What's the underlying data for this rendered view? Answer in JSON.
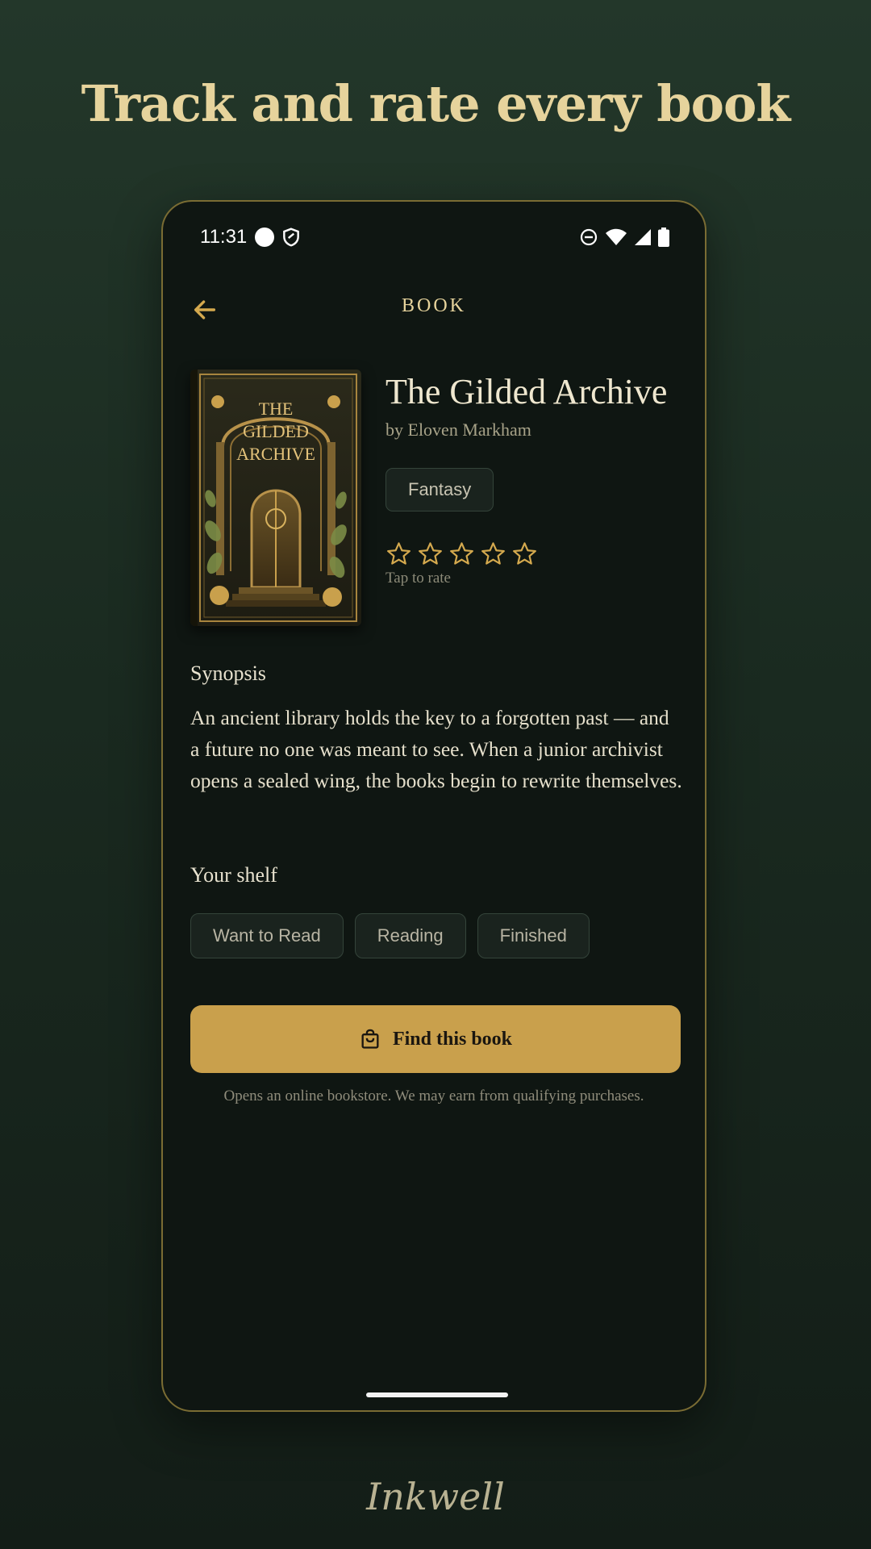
{
  "headline": "Track and rate every book",
  "status_bar": {
    "time": "11:31",
    "left_icons": [
      "notification-dot-icon",
      "shield-icon"
    ],
    "right_icons": [
      "do-not-disturb-icon",
      "wifi-icon",
      "signal-icon",
      "battery-icon"
    ]
  },
  "app_bar": {
    "title": "BOOK",
    "back_icon": "arrow-left-icon"
  },
  "book": {
    "title": "The Gilded Archive",
    "author": "by Eloven Markham",
    "genre": "Fantasy",
    "cover_text": [
      "THE",
      "GILDED",
      "ARCHIVE"
    ],
    "rating": {
      "value": 0,
      "max": 5
    },
    "rating_hint": "Tap to rate"
  },
  "synopsis": {
    "heading": "Synopsis",
    "text": "An ancient library holds the key to a forgotten past — and a future no one was meant to see. When a junior archivist opens a sealed wing, the books begin to rewrite themselves."
  },
  "shelf": {
    "heading": "Your shelf",
    "options": [
      "Want to Read",
      "Reading",
      "Finished"
    ]
  },
  "cta": {
    "label": "Find this book",
    "icon": "shopping-bag-icon",
    "disclaimer": "Opens an online bookstore. We may earn from qualifying purchases."
  },
  "brand": "Inkwell",
  "colors": {
    "accent_gold": "#c9a04c",
    "headline": "#e6d39c",
    "screen_bg": "#0f1612",
    "page_bg": "#1e3125"
  }
}
